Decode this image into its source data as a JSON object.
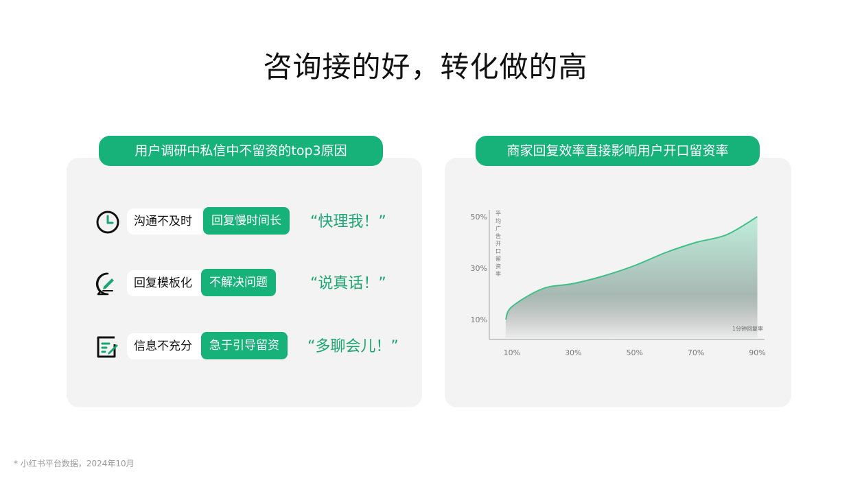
{
  "page_title": "咨询接的好，转化做的高",
  "left_panel": {
    "title": "用户调研中私信中不留资的top3原因",
    "rows": [
      {
        "icon": "clock-icon",
        "label": "沟通不及时",
        "tag": "回复慢时间长",
        "quote": "“快理我！”"
      },
      {
        "icon": "chat-edit-icon",
        "label": "回复模板化",
        "tag": "不解决问题",
        "quote": "“说真话！”"
      },
      {
        "icon": "form-edit-icon",
        "label": "信息不充分",
        "tag": "急于引导留资",
        "quote": "“多聊会儿！”"
      }
    ]
  },
  "right_panel": {
    "title": "商家回复效率直接影响用户开口留资率"
  },
  "chart_data": {
    "type": "area",
    "title": "",
    "xlabel": "1分钟回复率",
    "ylabel": "平均广告开口留资率",
    "x_ticks": [
      "10%",
      "30%",
      "50%",
      "70%",
      "90%"
    ],
    "y_ticks": [
      "10%",
      "30%",
      "50%"
    ],
    "x": [
      8,
      10,
      20,
      30,
      40,
      50,
      60,
      70,
      80,
      90
    ],
    "y": [
      10,
      15,
      22,
      24,
      27,
      31,
      36,
      40,
      43,
      50
    ],
    "xlim": [
      6,
      91
    ],
    "ylim": [
      10,
      50
    ],
    "colors": {
      "line": "#3fbf86",
      "fill_top": "#bfeedd",
      "fill_bottom": "#9a9a9a"
    }
  },
  "footnote": "* 小红书平台数据，2024年10月"
}
